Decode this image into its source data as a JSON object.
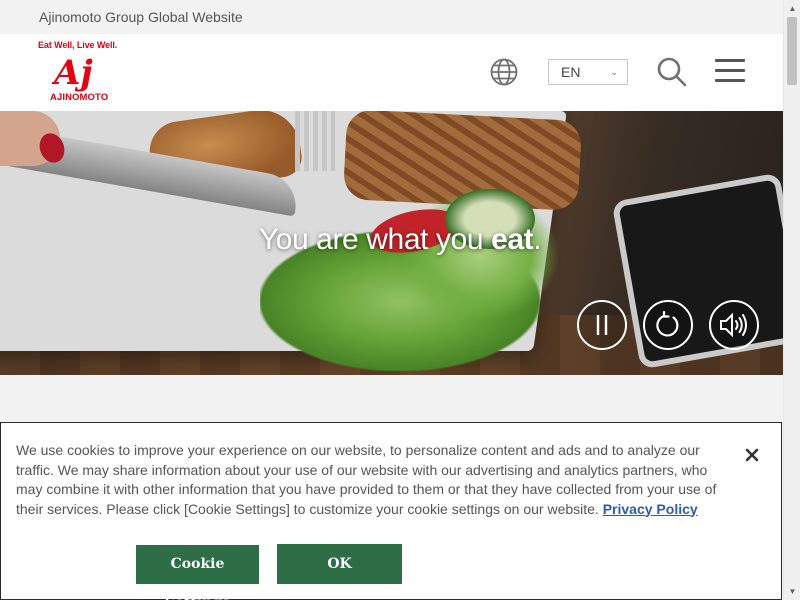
{
  "topbar": {
    "title": "Ajinomoto Group Global Website"
  },
  "logo": {
    "tagline": "Eat Well, Live Well.",
    "wordmark": "AJINOMOTO",
    "mark_text": "Aj",
    "brand_color": "#e60012"
  },
  "header": {
    "language": {
      "selected": "EN",
      "caret": "⌄"
    },
    "icons": [
      "globe-icon",
      "search-icon",
      "hamburger-menu-icon"
    ]
  },
  "hero": {
    "slogan_prefix": "You are what you ",
    "slogan_emphasis": "eat",
    "slogan_suffix": ".",
    "controls": [
      "pause-icon",
      "replay-icon",
      "sound-icon"
    ]
  },
  "cookie_banner": {
    "text": "We use cookies to improve your experience on our website, to personalize content and ads and to analyze our traffic. We may share information about your use of our website with our advertising and analytics partners, who may combine it with other information that you have provided to them or that they have collected from your use of their services. Please click [Cookie Settings] to customize your cookie settings on our website.",
    "policy_link": "Privacy Policy",
    "settings_button": "Cookie Settings",
    "ok_button": "OK",
    "button_color": "#2e6e47"
  },
  "scrollbar": {
    "up": "▲",
    "down": "▼"
  }
}
